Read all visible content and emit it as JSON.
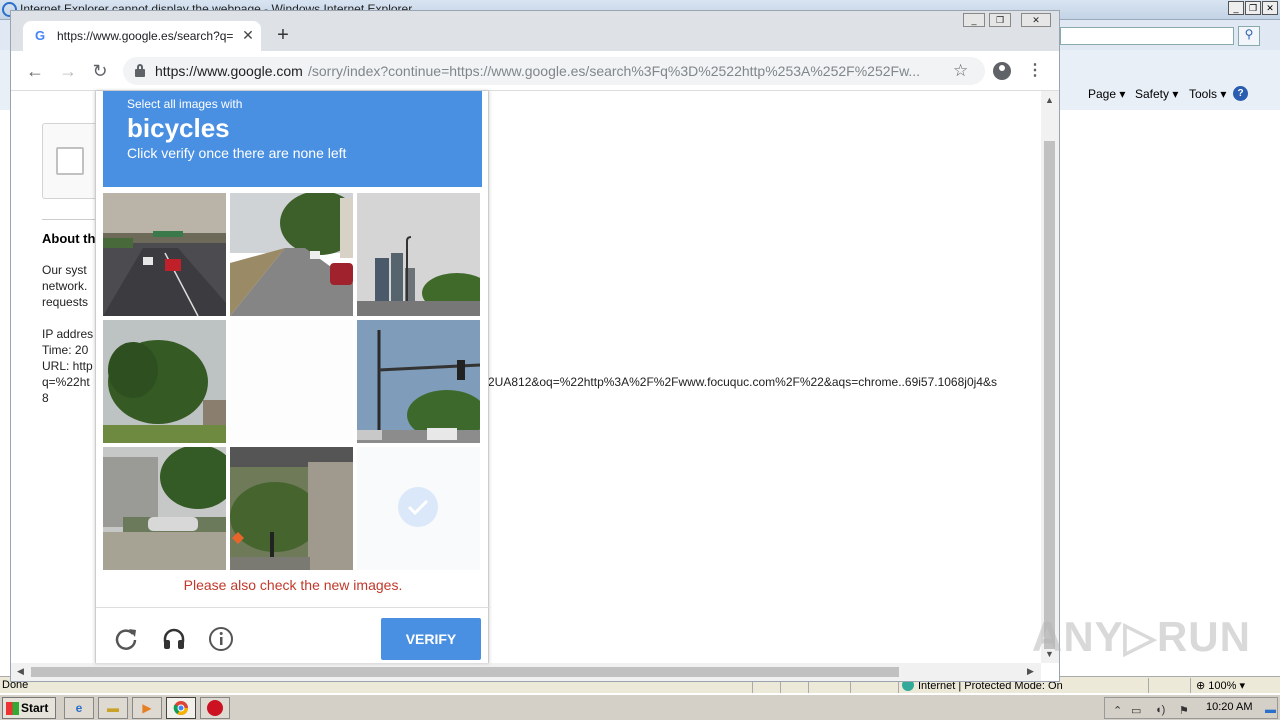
{
  "ie": {
    "title": "Internet Explorer cannot display the webpage - Windows Internet Explorer",
    "command_bar": {
      "page_label": "Page ▾",
      "safety_label": "Safety ▾",
      "tools_label": "Tools ▾",
      "help_label": "?"
    },
    "status": {
      "text": "Done",
      "zone": "Internet | Protected Mode: On",
      "zoom": "100%"
    }
  },
  "taskbar": {
    "start_label": "Start",
    "clock": "10:20 AM"
  },
  "chrome": {
    "tab": {
      "title": "https://www.google.es/search?q=%",
      "favicon": "G"
    },
    "omnibox": {
      "host": "https://www.google.com",
      "rest": "/sorry/index?continue=https://www.google.es/search%3Fq%3D%2522http%253A%252F%252Fw..."
    }
  },
  "page": {
    "about_heading": "About th",
    "lines_block1": [
      "Our syst",
      "network.",
      "requests"
    ],
    "lines_block2": [
      "IP addres",
      "Time: 20",
      "URL: http",
      "q=%22ht",
      "8"
    ],
    "url_tail": "2UA812&oq=%22http%3A%2F%2Fwww.focuquc.com%2F%22&aqs=chrome..69i57.1068j0j4&s"
  },
  "captcha": {
    "instruction": "Select all images with",
    "keyword": "bicycles",
    "subtext": "Click verify once there are none left",
    "error": "Please also check the new images.",
    "verify_label": "VERIFY",
    "tiles": [
      {
        "scene": "highway-overpass",
        "state": "visible"
      },
      {
        "scene": "street-trees",
        "state": "visible"
      },
      {
        "scene": "towers-streetlight",
        "state": "visible"
      },
      {
        "scene": "tree-house",
        "state": "visible"
      },
      {
        "scene": "blank",
        "state": "fading"
      },
      {
        "scene": "traffic-light",
        "state": "visible"
      },
      {
        "scene": "house-car",
        "state": "visible"
      },
      {
        "scene": "bridge-pillar",
        "state": "visible"
      },
      {
        "scene": "selected-faded",
        "state": "fading"
      }
    ],
    "accent_color": "#4a90e2",
    "error_color": "#c0392b"
  },
  "watermark": "ANY RUN"
}
